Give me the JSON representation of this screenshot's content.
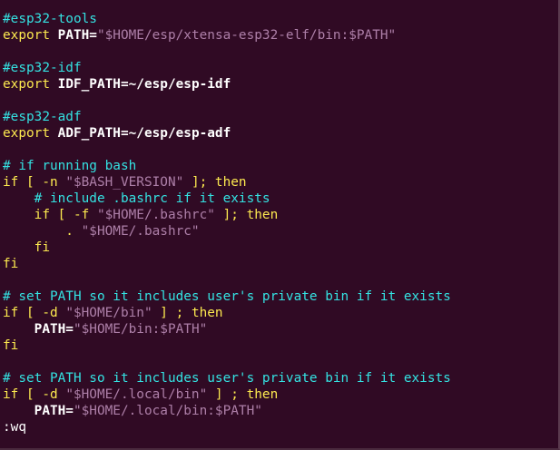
{
  "editor": {
    "lines": [
      [
        {
          "t": "#esp32-tools",
          "c": "cmt"
        }
      ],
      [
        {
          "t": "export ",
          "c": "kw"
        },
        {
          "t": "PATH=",
          "c": "var"
        },
        {
          "t": "\"$HOME/esp/xtensa-esp32-elf/bin:$PATH\"",
          "c": "str"
        }
      ],
      [],
      [
        {
          "t": "#esp32-idf",
          "c": "cmt"
        }
      ],
      [
        {
          "t": "export ",
          "c": "kw"
        },
        {
          "t": "IDF_PATH=~/esp/esp-idf",
          "c": "var"
        }
      ],
      [],
      [
        {
          "t": "#esp32-adf",
          "c": "cmt"
        }
      ],
      [
        {
          "t": "export ",
          "c": "kw"
        },
        {
          "t": "ADF_PATH=~/esp/esp-adf",
          "c": "var"
        }
      ],
      [],
      [
        {
          "t": "# if running bash",
          "c": "cmt"
        }
      ],
      [
        {
          "t": "if [ -n ",
          "c": "kw"
        },
        {
          "t": "\"$BASH_VERSION\"",
          "c": "str"
        },
        {
          "t": " ]; then",
          "c": "kw"
        }
      ],
      [
        {
          "t": "    # include .bashrc if it exists",
          "c": "cmt"
        }
      ],
      [
        {
          "t": "    if [ -f ",
          "c": "kw"
        },
        {
          "t": "\"$HOME/.bashrc\"",
          "c": "str"
        },
        {
          "t": " ]; then",
          "c": "kw"
        }
      ],
      [
        {
          "t": "        . ",
          "c": "kw"
        },
        {
          "t": "\"$HOME/.bashrc\"",
          "c": "str"
        }
      ],
      [
        {
          "t": "    fi",
          "c": "kw"
        }
      ],
      [
        {
          "t": "fi",
          "c": "kw"
        }
      ],
      [],
      [
        {
          "t": "# set PATH so it includes user's private bin if it exists",
          "c": "cmt"
        }
      ],
      [
        {
          "t": "if [ -d ",
          "c": "kw"
        },
        {
          "t": "\"$HOME/bin\"",
          "c": "str"
        },
        {
          "t": " ] ; then",
          "c": "kw"
        }
      ],
      [
        {
          "t": "    ",
          "c": "plain"
        },
        {
          "t": "PATH=",
          "c": "var"
        },
        {
          "t": "\"$HOME/bin:$PATH\"",
          "c": "str"
        }
      ],
      [
        {
          "t": "fi",
          "c": "kw"
        }
      ],
      [],
      [
        {
          "t": "# set PATH so it includes user's private bin if it exists",
          "c": "cmt"
        }
      ],
      [
        {
          "t": "if [ -d ",
          "c": "kw"
        },
        {
          "t": "\"$HOME/.local/bin\"",
          "c": "str"
        },
        {
          "t": " ] ; then",
          "c": "kw"
        }
      ],
      [
        {
          "t": "    ",
          "c": "plain"
        },
        {
          "t": "PATH=",
          "c": "var"
        },
        {
          "t": "\"$HOME/.local/bin:$PATH\"",
          "c": "str"
        }
      ]
    ],
    "command_line": ":wq"
  },
  "colors": {
    "background": "#300a24",
    "comment": "#34e2e2",
    "keyword": "#fce94f",
    "string": "#ad7fa8",
    "variable": "#ffffff"
  }
}
